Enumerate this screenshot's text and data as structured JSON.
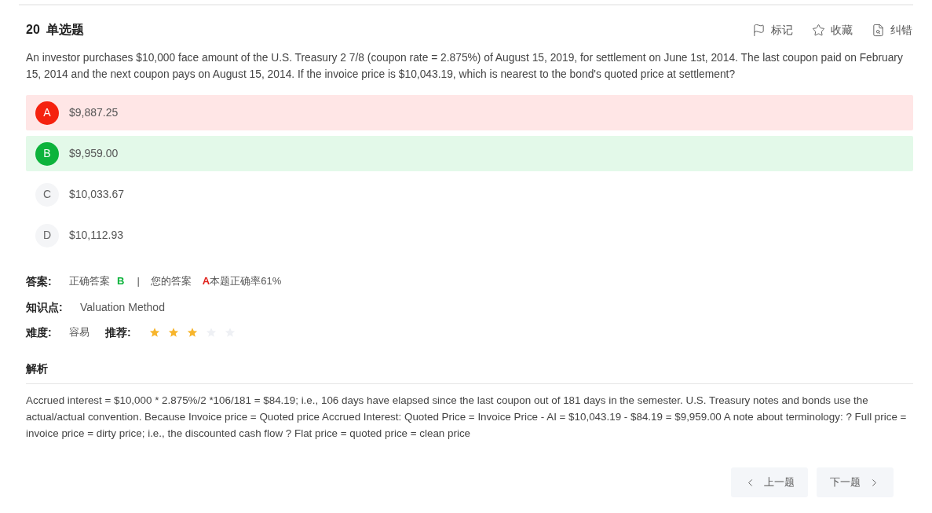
{
  "question": {
    "number": "20",
    "type": "单选题",
    "text": "An investor purchases $10,000 face amount of the U.S. Treasury 2 7/8 (coupon rate = 2.875%) of August 15, 2019, for settlement on June 1st, 2014. The last coupon paid on February 15, 2014 and the next coupon pays on August 15, 2014. If the invoice price is $10,043.19, which is nearest to the bond's quoted price at settlement?"
  },
  "actions": [
    {
      "kind": "flag",
      "label": "标记"
    },
    {
      "kind": "star",
      "label": "收藏"
    },
    {
      "kind": "report",
      "label": "纠错"
    }
  ],
  "options": [
    {
      "letter": "A",
      "text": "$9,887.25",
      "kind": "wrong"
    },
    {
      "letter": "B",
      "text": "$9,959.00",
      "kind": "correct"
    },
    {
      "letter": "C",
      "text": "$10,033.67",
      "kind": "plain"
    },
    {
      "letter": "D",
      "text": "$10,112.93",
      "kind": "plain"
    }
  ],
  "answer": {
    "label": "答案:",
    "correct_label": "正确答案",
    "correct": "B",
    "separator": "|",
    "yours_label": "您的答案",
    "yours": "A",
    "rate": "本题正确率61%"
  },
  "knowledge": {
    "label": "知识点:",
    "value": "Valuation Method"
  },
  "difficulty": {
    "label": "难度:",
    "value": "容易"
  },
  "recommend": {
    "label": "推荐:",
    "stars": 3
  },
  "analysis": {
    "title": "解析",
    "text": "Accrued interest = $10,000 * 2.875%/2 *106/181 = $84.19; i.e., 106 days have elapsed since the last coupon out of 181 days in the semester. U.S. Treasury notes and bonds use the actual/actual convention. Because Invoice price = Quoted price Accrued Interest: Quoted Price = Invoice Price - AI = $10,043.19 - $84.19 = $9,959.00 A note about terminology: ? Full price = invoice price = dirty price; i.e., the discounted cash flow ? Flat price = quoted price = clean price"
  },
  "nav": {
    "prev": "上一题",
    "next": "下一题"
  }
}
